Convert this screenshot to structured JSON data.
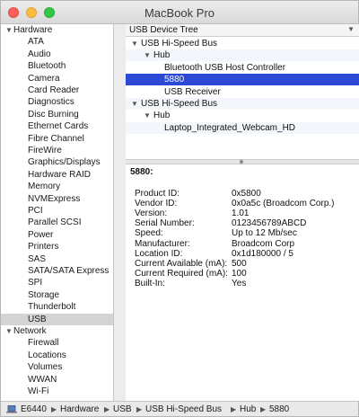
{
  "window": {
    "title": "MacBook Pro"
  },
  "sidebar": {
    "groups": [
      {
        "label": "Hardware",
        "expanded": true,
        "items": [
          "ATA",
          "Audio",
          "Bluetooth",
          "Camera",
          "Card Reader",
          "Diagnostics",
          "Disc Burning",
          "Ethernet Cards",
          "Fibre Channel",
          "FireWire",
          "Graphics/Displays",
          "Hardware RAID",
          "Memory",
          "NVMExpress",
          "PCI",
          "Parallel SCSI",
          "Power",
          "Printers",
          "SAS",
          "SATA/SATA Express",
          "SPI",
          "Storage",
          "Thunderbolt",
          "USB"
        ]
      },
      {
        "label": "Network",
        "expanded": true,
        "items": [
          "Firewall",
          "Locations",
          "Volumes",
          "WWAN",
          "Wi-Fi"
        ]
      }
    ],
    "selected": "USB"
  },
  "tree": {
    "header": "USB Device Tree",
    "rows": [
      {
        "label": "USB Hi-Speed Bus",
        "level": 0,
        "expanded": true
      },
      {
        "label": "Hub",
        "level": 1,
        "expanded": true
      },
      {
        "label": "Bluetooth USB Host Controller",
        "level": 2
      },
      {
        "label": "5880",
        "level": 2,
        "selected": true
      },
      {
        "label": "USB Receiver",
        "level": 2
      },
      {
        "label": "USB Hi-Speed Bus",
        "level": 0,
        "expanded": true
      },
      {
        "label": "Hub",
        "level": 1,
        "expanded": true
      },
      {
        "label": "Laptop_Integrated_Webcam_HD",
        "level": 2
      }
    ]
  },
  "details": {
    "title": "5880:",
    "fields": [
      {
        "key": "Product ID:",
        "value": "0x5800"
      },
      {
        "key": "Vendor ID:",
        "value": "0x0a5c  (Broadcom Corp.)"
      },
      {
        "key": "Version:",
        "value": "1.01"
      },
      {
        "key": "Serial Number:",
        "value": "0123456789ABCD"
      },
      {
        "key": "Speed:",
        "value": "Up to 12 Mb/sec"
      },
      {
        "key": "Manufacturer:",
        "value": "Broadcom Corp"
      },
      {
        "key": "Location ID:",
        "value": "0x1d180000 / 5"
      },
      {
        "key": "Current Available (mA):",
        "value": "500"
      },
      {
        "key": "Current Required (mA):",
        "value": "100"
      },
      {
        "key": "Built-In:",
        "value": "Yes"
      }
    ]
  },
  "pathbar": {
    "icon": "laptop-icon",
    "crumbs": [
      "E6440",
      "Hardware",
      "USB",
      "USB Hi-Speed Bus",
      "Hub",
      "5880"
    ]
  },
  "colors": {
    "selection": "#2c49d5",
    "sidebar_selection": "#d4d4d4"
  }
}
